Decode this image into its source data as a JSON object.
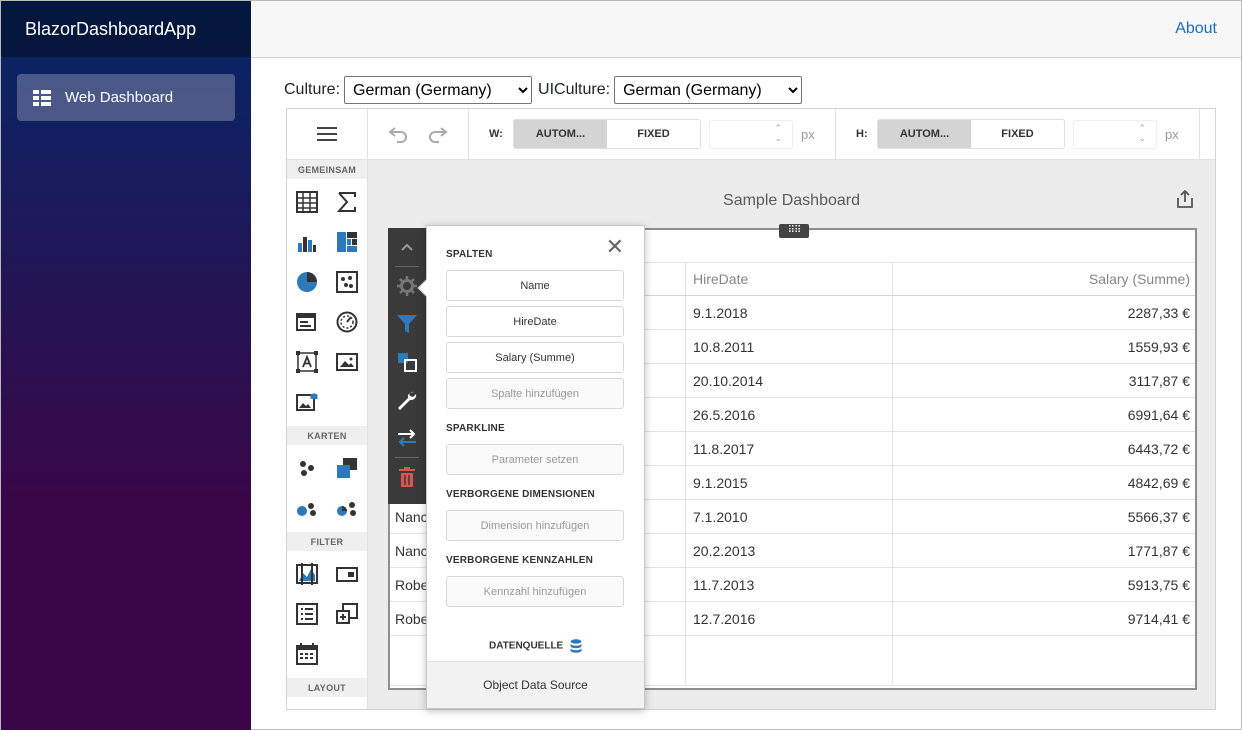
{
  "app": {
    "title": "BlazorDashboardApp"
  },
  "sidebar": {
    "items": [
      {
        "label": "Web Dashboard",
        "icon": "dashboard-icon"
      }
    ]
  },
  "topbar": {
    "about_label": "About"
  },
  "culture": {
    "culture_label": "Culture:",
    "culture_value": "German (Germany)",
    "uiculture_label": "UICulture:",
    "uiculture_value": "German (Germany)"
  },
  "toolbox": {
    "groups": {
      "common": "GEMEINSAM",
      "maps": "KARTEN",
      "filter": "FILTER",
      "layout": "LAYOUT"
    }
  },
  "toolbar": {
    "width_label": "W:",
    "height_label": "H:",
    "auto_label": "AUTOM...",
    "fixed_label": "FIXED",
    "px_label": "px"
  },
  "dashboard": {
    "title": "Sample Dashboard",
    "grid": {
      "columns": [
        "",
        "HireDate",
        "Salary (Summe)"
      ],
      "rows": [
        [
          "",
          "9.1.2018",
          "2287,33 €"
        ],
        [
          "",
          "10.8.2011",
          "1559,93 €"
        ],
        [
          "",
          "20.10.2014",
          "3117,87 €"
        ],
        [
          "",
          "26.5.2016",
          "6991,64 €"
        ],
        [
          "",
          "11.8.2017",
          "6443,72 €"
        ],
        [
          "",
          "9.1.2015",
          "4842,69 €"
        ],
        [
          "Nanc",
          "7.1.2010",
          "5566,37 €"
        ],
        [
          "Nanc",
          "20.2.2013",
          "1771,87 €"
        ],
        [
          "Robe",
          "11.7.2013",
          "5913,75 €"
        ],
        [
          "Robe",
          "12.7.2016",
          "9714,41 €"
        ]
      ]
    }
  },
  "popup": {
    "columns_title": "SPALTEN",
    "columns": [
      "Name",
      "HireDate",
      "Salary (Summe)"
    ],
    "add_column": "Spalte hinzufügen",
    "sparkline_title": "SPARKLINE",
    "set_parameter": "Parameter setzen",
    "hidden_dimensions_title": "VERBORGENE DIMENSIONEN",
    "add_dimension": "Dimension hinzufügen",
    "hidden_measures_title": "VERBORGENE KENNZAHLEN",
    "add_measure": "Kennzahl hinzufügen",
    "datasource_title": "DATENQUELLE",
    "datasource_name": "Object Data Source"
  },
  "colors": {
    "accent": "#2e79b9",
    "link": "#1b6ec2",
    "delete": "#d9534f"
  }
}
